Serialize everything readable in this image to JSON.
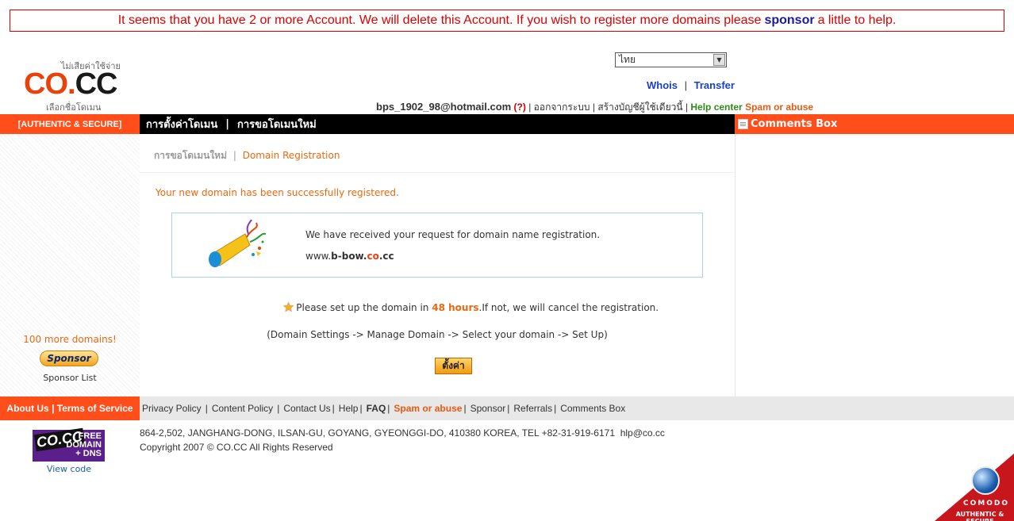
{
  "alert": {
    "text_before": "It seems that you have 2 or more Account. We will delete this Account. If you wish to register more domains please",
    "sponsor_link": "sponsor",
    "text_after": "a little to help."
  },
  "logo": {
    "tag_top": "ไม่เสียค่าใช้จ่าย",
    "co": "CO",
    "dot": ".",
    "cc": "CC",
    "tag_bottom": "เลือกชื่อโดเมน"
  },
  "language_select": {
    "value": "ไทย"
  },
  "top_links": {
    "whois": "Whois",
    "sep": "|",
    "transfer": "Transfer"
  },
  "user_bar": {
    "email": "bps_1902_98@hotmail.com",
    "question": "(?)",
    "logout": "ออกจากระบบ",
    "new_account": "สร้างบัญชีผู้ใช้เดียวนี้",
    "help_center": "Help center",
    "spam": "Spam or abuse"
  },
  "nav": {
    "left_label": "[AUTHENTIC & SECURE]",
    "domain_settings": "การตั้งค่าโดเมน",
    "sep": "|",
    "new_domain": "การขอโดเมนใหม่",
    "comments_box": "Comments Box"
  },
  "sidebar": {
    "more_domains": "100 more domains!",
    "sponsor_button": "Sponsor",
    "sponsor_list": "Sponsor List"
  },
  "main": {
    "breadcrumb_parent": "การขอโดเมนใหม่",
    "breadcrumb_sep": "|",
    "breadcrumb_current": "Domain Registration",
    "success_message": "Your new domain has been successfully registered.",
    "received_message": "We have received your request for domain name registration.",
    "domain_prefix": "www.",
    "domain_name": "b-bow",
    "domain_dot": ".",
    "domain_co": "co",
    "domain_tld": ".cc",
    "notice_before": "Please set up the domain in",
    "notice_hours": "48 hours",
    "notice_after": ".If not, we will cancel the registration.",
    "steps": "(Domain Settings -> Manage Domain -> Select your domain -> Set Up)",
    "setup_button": "ตั้งค่า"
  },
  "footer": {
    "left_label": "About Us | Terms of Service",
    "links": {
      "privacy": "Privacy Policy",
      "content": "Content Policy",
      "contact": "Contact Us",
      "help": "Help",
      "faq": "FAQ",
      "spam": "Spam or abuse",
      "sponsor": "Sponsor",
      "referrals": "Referrals",
      "comments": "Comments Box"
    },
    "badge_co": "CO.CC",
    "badge_free": "FREE",
    "badge_domain": "DOMAIN",
    "badge_dns": "+ DNS",
    "view_code": "View code",
    "address": "864-2,502, JANGHANG-DONG, ILSAN-GU, GOYANG, GYEONGGI-DO, 410380 KOREA, TEL +82-31-919-6171",
    "email": "hlp@co.cc",
    "copyright": "Copyright 2007 © CO.CC All Rights Reserved"
  },
  "comodo": {
    "brand": "COMODO",
    "tagline": "AUTHENTIC & SECURE"
  },
  "colors": {
    "accent_orange": "#ff4e1a",
    "alert_red": "#dd0000",
    "link_blue": "#1a3fcc",
    "help_green": "#2f8a18"
  }
}
